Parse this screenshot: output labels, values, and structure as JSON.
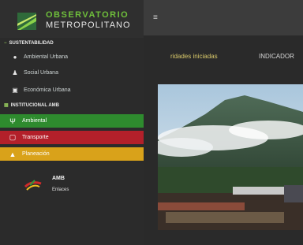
{
  "logo": {
    "line1": "OBSERVATORIO",
    "line2": "METROPOLITANO"
  },
  "sidebar": {
    "section_sustentabilidad": "SUSTENTABILIDAD",
    "items": [
      {
        "label": "Ambiental Urbana",
        "icon": "leaf-icon"
      },
      {
        "label": "Social Urbana",
        "icon": "people-icon"
      },
      {
        "label": "Económica Urbana",
        "icon": "money-icon"
      }
    ],
    "section_institucional": "INSTITUCIONAL AMB",
    "bands": [
      {
        "label": "Ambiental",
        "icon": "plant-icon",
        "color": "#2e8b2e"
      },
      {
        "label": "Transporte",
        "icon": "bus-icon",
        "color": "#b3202a"
      },
      {
        "label": "Planeación",
        "icon": "cone-icon",
        "color": "#d9a21a"
      }
    ],
    "amb": {
      "title": "AMB",
      "subtitle": "Enlaces"
    }
  },
  "topbar": {
    "menu_icon": "hamburger-icon"
  },
  "main": {
    "tabs": [
      {
        "label": "ridades iniciadas"
      },
      {
        "label": "INDICADOR"
      }
    ]
  }
}
